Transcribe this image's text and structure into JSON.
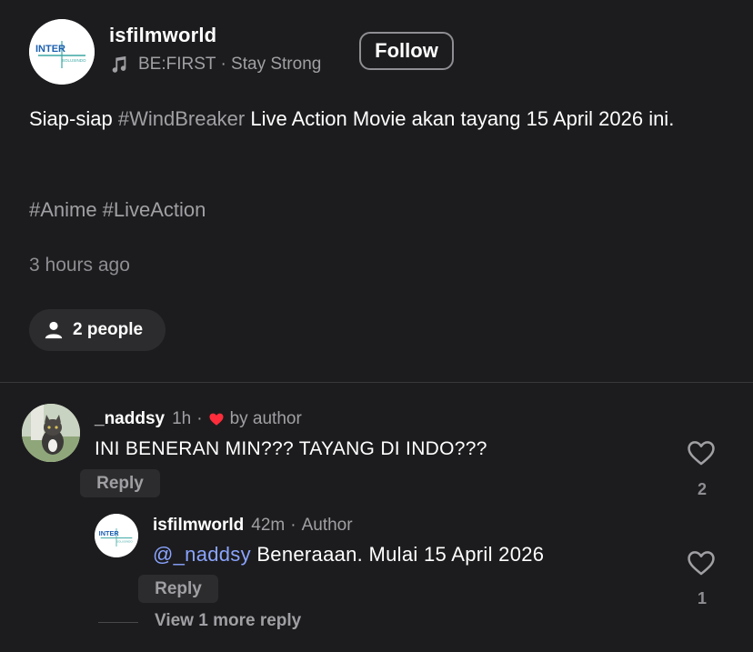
{
  "post": {
    "author": "isfilmworld",
    "avatar_logo": {
      "line1": "INTER",
      "line2": "SOLUSINDO"
    },
    "music": {
      "icon": "music-note-icon",
      "text": "BE:FIRST · Stay Strong"
    },
    "follow_label": "Follow",
    "text_prefix": "Siap-siap ",
    "text_hashtag": "#WindBreaker",
    "text_suffix": " Live Action Movie akan tayang 15 April 2026 ini.",
    "tags": [
      "#Anime",
      "#LiveAction"
    ],
    "time": "3 hours ago",
    "people_chip": "2 people"
  },
  "comments": [
    {
      "user": "_naddsy",
      "time": "1h",
      "separator": "·",
      "liked_by_author": "by author",
      "text": "INI BENERAN MIN??? TAYANG DI INDO???",
      "reply_label": "Reply",
      "like_count": "2",
      "replies": [
        {
          "user": "isfilmworld",
          "time": "42m",
          "separator": "·",
          "badge": "Author",
          "mention": "@_naddsy",
          "text": " Beneraaan. Mulai 15 April 2026",
          "reply_label": "Reply",
          "like_count": "1"
        }
      ],
      "more_replies": "View 1 more reply"
    }
  ],
  "colors": {
    "background": "#1c1c1e",
    "secondary_text": "#a0a0a4",
    "mention": "#8aa4ff",
    "heart": "#ff2d3c"
  }
}
